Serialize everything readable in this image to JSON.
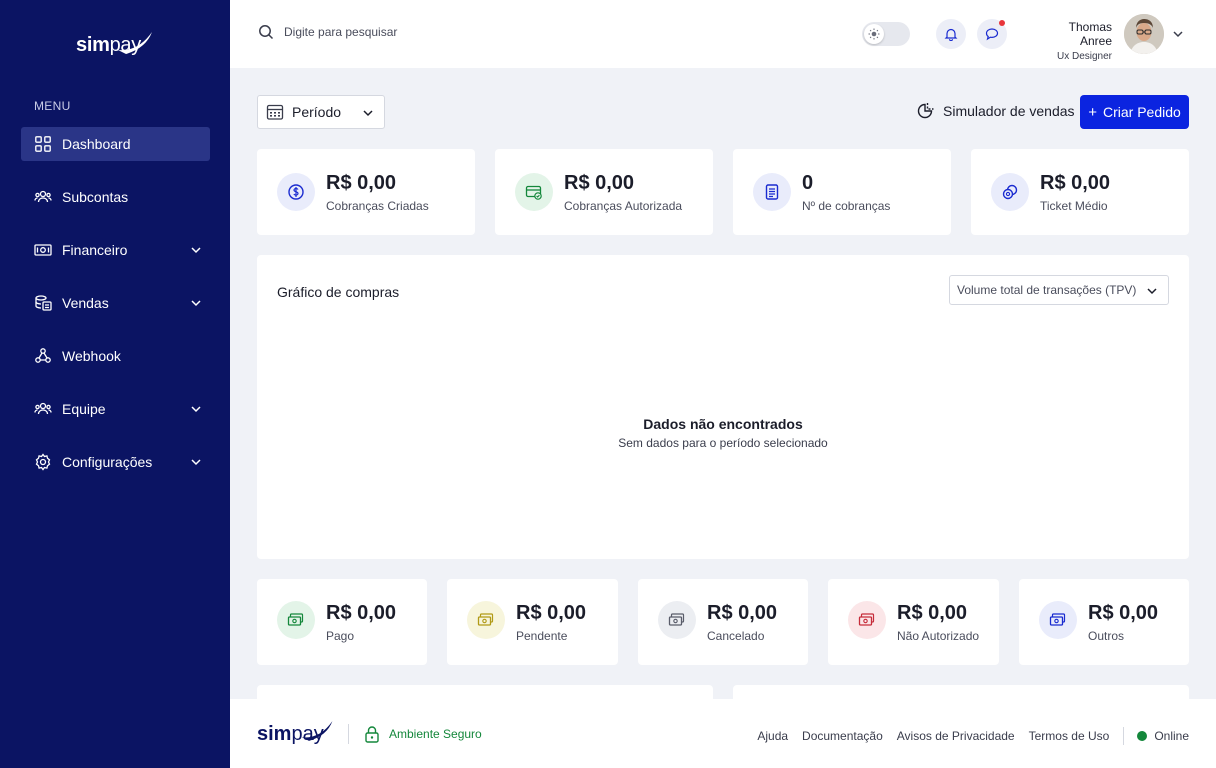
{
  "brand": {
    "logo_text": "simpay"
  },
  "sidebar": {
    "menu_title": "MENU",
    "items": [
      {
        "label": "Dashboard",
        "icon": "grid-icon",
        "active": true,
        "has_submenu": false
      },
      {
        "label": "Subcontas",
        "icon": "users-icon",
        "active": false,
        "has_submenu": false
      },
      {
        "label": "Financeiro",
        "icon": "money-icon",
        "active": false,
        "has_submenu": true
      },
      {
        "label": "Vendas",
        "icon": "sales-icon",
        "active": false,
        "has_submenu": true
      },
      {
        "label": "Webhook",
        "icon": "webhook-icon",
        "active": false,
        "has_submenu": false
      },
      {
        "label": "Equipe",
        "icon": "team-icon",
        "active": false,
        "has_submenu": true
      },
      {
        "label": "Configurações",
        "icon": "gear-icon",
        "active": false,
        "has_submenu": true
      }
    ]
  },
  "topbar": {
    "search_placeholder": "Digite para pesquisar",
    "user": {
      "name": "Thomas Anree",
      "role": "Ux Designer"
    }
  },
  "toolbar": {
    "period_label": "Período",
    "simulator_label": "Simulador de vendas",
    "create_label": "Criar Pedido",
    "create_prefix": "+"
  },
  "stats": [
    {
      "value": "R$ 0,00",
      "label": "Cobranças Criadas",
      "icon": "dollar-icon",
      "bg": "#e9ecfb",
      "color": "#1a2bd0"
    },
    {
      "value": "R$ 0,00",
      "label": "Cobranças Autorizada",
      "icon": "card-check-icon",
      "bg": "#e3f4e8",
      "color": "#14873b"
    },
    {
      "value": "0",
      "label": "Nº de cobranças",
      "icon": "document-icon",
      "bg": "#e9ecfb",
      "color": "#1a2bd0"
    },
    {
      "value": "R$ 0,00",
      "label": "Ticket Médio",
      "icon": "coins-icon",
      "bg": "#e9ecfb",
      "color": "#1a2bd0"
    }
  ],
  "chart_panel": {
    "title": "Gráfico de compras",
    "select_value": "Volume total de transações (TPV)",
    "empty_title": "Dados não encontrados",
    "empty_subtitle": "Sem dados para o período selecionado"
  },
  "status_cards": [
    {
      "value": "R$ 0,00",
      "label": "Pago",
      "icon": "cash-icon",
      "bg": "#e3f4e8",
      "color": "#14873b"
    },
    {
      "value": "R$ 0,00",
      "label": "Pendente",
      "icon": "cash-icon",
      "bg": "#f7f5dc",
      "color": "#b19a16"
    },
    {
      "value": "R$ 0,00",
      "label": "Cancelado",
      "icon": "cash-icon",
      "bg": "#eceef2",
      "color": "#5a5d6a"
    },
    {
      "value": "R$ 0,00",
      "label": "Não Autorizado",
      "icon": "cash-icon",
      "bg": "#fbe6e8",
      "color": "#c62c3a"
    },
    {
      "value": "R$ 0,00",
      "label": "Outros",
      "icon": "cash-icon",
      "bg": "#e9ecfb",
      "color": "#1a2bd0"
    }
  ],
  "footer": {
    "logo_text": "simpay",
    "secure_label": "Ambiente Seguro",
    "links": [
      "Ajuda",
      "Documentação",
      "Avisos de Privacidade",
      "Termos de Uso"
    ],
    "status_label": "Online"
  },
  "colors": {
    "sidebar_bg": "#0b1463",
    "primary": "#0b24e0",
    "success": "#14873b"
  }
}
